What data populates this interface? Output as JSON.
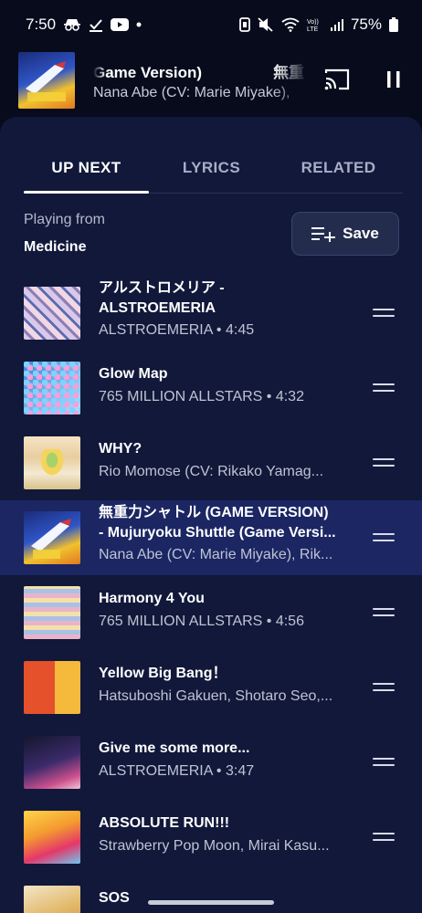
{
  "status_bar": {
    "time": "7:50",
    "battery": "75%",
    "icons": [
      "incognito-icon",
      "download-done-icon",
      "youtube-icon",
      "dot-icon",
      "nfc-icon",
      "mute-icon",
      "wifi-icon",
      "volte-icon",
      "signal-icon",
      "battery-icon"
    ]
  },
  "mini_player": {
    "title": "Game Version)",
    "title_tail": "無重",
    "artist": "Nana Abe (CV: Marie Miyake),",
    "cast_icon": "cast-icon",
    "pause_icon": "pause-icon"
  },
  "tabs": [
    {
      "label": "UP NEXT",
      "active": true
    },
    {
      "label": "LYRICS",
      "active": false
    },
    {
      "label": "RELATED",
      "active": false
    }
  ],
  "playing_from": {
    "label": "Playing from",
    "playlist": "Medicine",
    "save_label": "Save",
    "save_icon": "playlist-add-icon"
  },
  "queue": [
    {
      "title": "アルストロメリア -",
      "title2": "ALSTROEMERIA",
      "subtitle": "ALSTROEMERIA • 4:45",
      "thumb": "t-alstro",
      "current": false
    },
    {
      "title": "Glow Map",
      "subtitle": "765 MILLION ALLSTARS • 4:32",
      "thumb": "t-glow",
      "current": false
    },
    {
      "title": "WHY?",
      "subtitle": "Rio Momose (CV: Rikako Yamag...",
      "thumb": "t-why",
      "current": false
    },
    {
      "title": "無重力シャトル (GAME VERSION)",
      "title2": "- Mujuryoku Shuttle (Game Versi...",
      "subtitle": "Nana Abe (CV: Marie Miyake), Rik...",
      "thumb": "t-muju",
      "current": true
    },
    {
      "title": "Harmony 4 You",
      "subtitle": "765 MILLION ALLSTARS • 4:56",
      "thumb": "t-harmony",
      "current": false
    },
    {
      "title": "Yellow Big Bang！",
      "subtitle": "Hatsuboshi Gakuen, Shotaro Seo,...",
      "thumb": "t-yellow",
      "current": false
    },
    {
      "title": "Give me some more...",
      "subtitle": "ALSTROEMERIA • 3:47",
      "thumb": "t-give",
      "current": false
    },
    {
      "title": "ABSOLUTE RUN!!!",
      "subtitle": "Strawberry Pop Moon, Mirai Kasu...",
      "thumb": "t-absolute",
      "current": false
    },
    {
      "title": "SOS",
      "subtitle": "",
      "thumb": "t-sos",
      "current": false
    }
  ],
  "colors": {
    "background": "#070b1c",
    "sheet": "#11183a",
    "current_row": "#1b2663",
    "secondary_text": "#bfc3d3"
  }
}
